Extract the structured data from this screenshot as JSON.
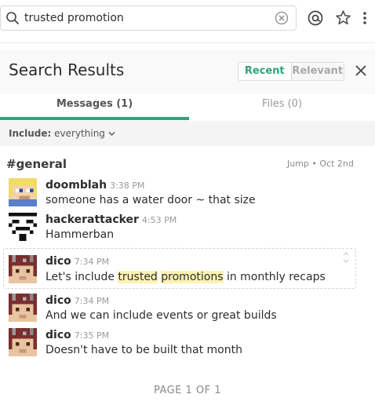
{
  "search": {
    "value": "trusted promotion"
  },
  "header": {
    "title": "Search Results",
    "sort": {
      "recent": "Recent",
      "relevant": "Relevant"
    }
  },
  "tabs": {
    "messages": "Messages (1)",
    "files": "Files (0)"
  },
  "filter": {
    "label": "Include:",
    "value": "everything"
  },
  "channel": {
    "name": "#general",
    "jump": "Jump • Oct 2nd"
  },
  "messages": [
    {
      "user": "doomblah",
      "time": "3:38 PM",
      "text": "someone has a water door ~ that size"
    },
    {
      "user": "hackerattacker",
      "time": "4:53 PM",
      "text": "Hammerban"
    },
    {
      "user": "dico",
      "time": "7:34 PM",
      "text_before": "Let's include ",
      "hl1": "trusted",
      "text_mid": " ",
      "hl2": "promotions",
      "text_after": " in monthly recaps"
    },
    {
      "user": "dico",
      "time": "7:34 PM",
      "text": "And we can include events or great builds"
    },
    {
      "user": "dico",
      "time": "7:35 PM",
      "text": "Doesn't have to be built that month"
    }
  ],
  "pager": "PAGE 1 OF 1",
  "colors": {
    "accent": "#2fa37a",
    "highlight": "#fcf3b3"
  }
}
